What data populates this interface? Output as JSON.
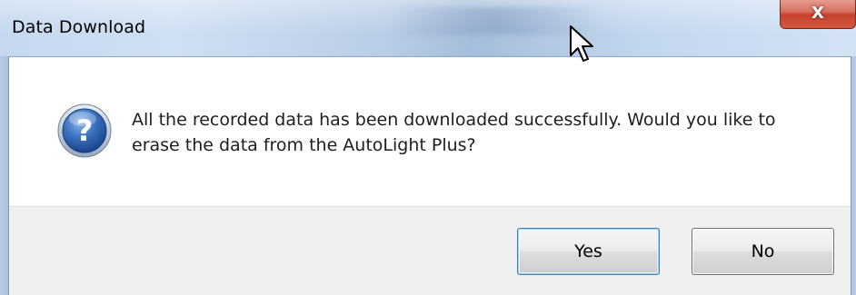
{
  "window": {
    "title": "Data Download",
    "close_glyph": "X"
  },
  "dialog": {
    "icon": "question-icon",
    "message": "All the recorded data has been downloaded successfully.  Would you like to erase the data from the AutoLight Plus?"
  },
  "buttons": {
    "yes_label": "Yes",
    "no_label": "No"
  },
  "colors": {
    "title_bar": "#bfd3ec",
    "close_button": "#c94a34",
    "footer": "#f0f0f0",
    "default_button_border": "#3c7fb1",
    "icon_blue": "#2a5ea8"
  }
}
